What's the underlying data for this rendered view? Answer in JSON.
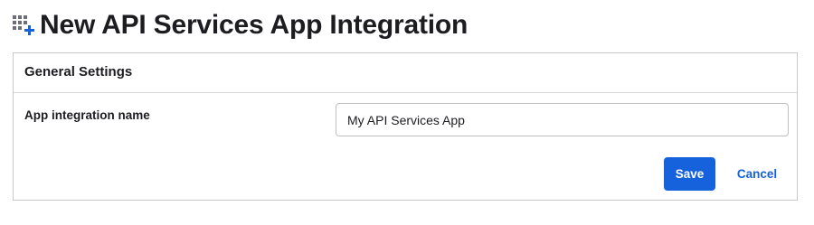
{
  "header": {
    "icon": "add-app-grid-icon",
    "title": "New API Services App Integration"
  },
  "general_settings": {
    "title": "General Settings",
    "app_name_label": "App integration name",
    "app_name_value": "My API Services App"
  },
  "actions": {
    "save_label": "Save",
    "cancel_label": "Cancel"
  },
  "colors": {
    "primary": "#1662dd",
    "text": "#1d1d21",
    "border": "#c9c9cc",
    "icon_gray": "#6e6e78"
  }
}
